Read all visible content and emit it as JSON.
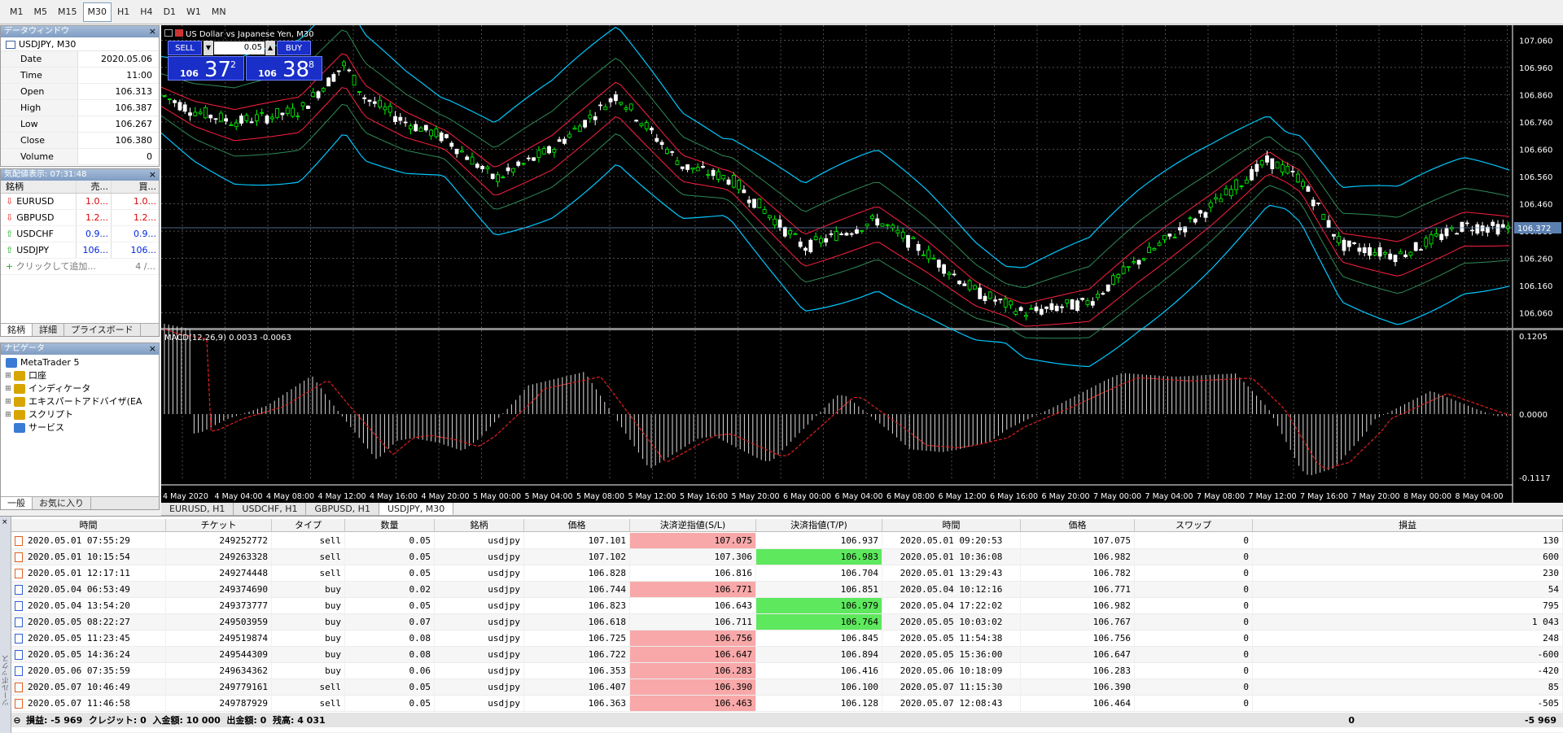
{
  "timeframes": [
    "M1",
    "M5",
    "M15",
    "M30",
    "H1",
    "H4",
    "D1",
    "W1",
    "MN"
  ],
  "active_timeframe": "M30",
  "data_window": {
    "title": "データウィンドウ",
    "symbol": "USDJPY, M30",
    "rows": [
      {
        "k": "Date",
        "v": "2020.05.06"
      },
      {
        "k": "Time",
        "v": "11:00"
      },
      {
        "k": "Open",
        "v": "106.313"
      },
      {
        "k": "High",
        "v": "106.387"
      },
      {
        "k": "Low",
        "v": "106.267"
      },
      {
        "k": "Close",
        "v": "106.380"
      },
      {
        "k": "Volume",
        "v": "0"
      }
    ]
  },
  "market_watch": {
    "title": "気配値表示: 07:31:48",
    "headers": [
      "銘柄",
      "売...",
      "買..."
    ],
    "rows": [
      {
        "sym": "EURUSD",
        "bid": "1.0...",
        "ask": "1.0...",
        "dir": "dn"
      },
      {
        "sym": "GBPUSD",
        "bid": "1.2...",
        "ask": "1.2...",
        "dir": "dn"
      },
      {
        "sym": "USDCHF",
        "bid": "0.9...",
        "ask": "0.9...",
        "dir": "up"
      },
      {
        "sym": "USDJPY",
        "bid": "106...",
        "ask": "106...",
        "dir": "up"
      }
    ],
    "add": "クリックして追加...",
    "count": "4 /...",
    "tabs": [
      "銘柄",
      "詳細",
      "プライスボード"
    ]
  },
  "navigator": {
    "title": "ナビゲータ",
    "root": "MetaTrader 5",
    "items": [
      "口座",
      "インディケータ",
      "エキスパートアドバイザ(EA",
      "スクリプト",
      "サービス"
    ],
    "tabs": [
      "一般",
      "お気に入り"
    ]
  },
  "chart": {
    "title": "US Dollar vs Japanese Yen, M30",
    "sell_label": "SELL",
    "buy_label": "BUY",
    "lot": "0.05",
    "bid_prefix": "106",
    "bid_big": "37",
    "bid_sup": "2",
    "ask_prefix": "106",
    "ask_big": "38",
    "ask_sup": "8",
    "price_labels": [
      "107.060",
      "106.960",
      "106.860",
      "106.760",
      "106.660",
      "106.560",
      "106.460",
      "106.360",
      "106.260",
      "106.160",
      "106.060"
    ],
    "current_price": "106.372",
    "macd_label": "MACD(12,26,9) 0.0033 -0.0063",
    "macd_labels": [
      "0.1205",
      "0.0000",
      "-0.1117"
    ],
    "time_labels": [
      "4 May 2020",
      "4 May 04:00",
      "4 May 08:00",
      "4 May 12:00",
      "4 May 16:00",
      "4 May 20:00",
      "5 May 00:00",
      "5 May 04:00",
      "5 May 08:00",
      "5 May 12:00",
      "5 May 16:00",
      "5 May 20:00",
      "6 May 00:00",
      "6 May 04:00",
      "6 May 08:00",
      "6 May 12:00",
      "6 May 16:00",
      "6 May 20:00",
      "7 May 00:00",
      "7 May 04:00",
      "7 May 08:00",
      "7 May 12:00",
      "7 May 16:00",
      "7 May 20:00",
      "8 May 00:00",
      "8 May 04:00"
    ],
    "tabs": [
      "EURUSD, H1",
      "USDCHF, H1",
      "GBPUSD, H1",
      "USDJPY, M30"
    ],
    "active_tab": "USDJPY, M30",
    "colors": {
      "up": "#00ff00",
      "down": "#ffffff",
      "bb_outer": "#00c8ff",
      "bb_mid": "#ff2040",
      "bb_inner": "#2e8b57",
      "grid": "#7f7f7f"
    }
  },
  "history": {
    "headers": [
      "時間",
      "チケット",
      "タイプ",
      "数量",
      "銘柄",
      "価格",
      "決済逆指値(S/L)",
      "決済指値(T/P)",
      "時間",
      "価格",
      "スワップ",
      "損益"
    ],
    "rows": [
      [
        "2020.05.01 07:55:29",
        "249252772",
        "sell",
        "0.05",
        "usdjpy",
        "107.101",
        "107.075",
        "106.937",
        "2020.05.01 09:20:53",
        "107.075",
        "0",
        "130",
        "sl"
      ],
      [
        "2020.05.01 10:15:54",
        "249263328",
        "sell",
        "0.05",
        "usdjpy",
        "107.102",
        "107.306",
        "106.983",
        "2020.05.01 10:36:08",
        "106.982",
        "0",
        "600",
        "tp"
      ],
      [
        "2020.05.01 12:17:11",
        "249274448",
        "sell",
        "0.05",
        "usdjpy",
        "106.828",
        "106.816",
        "106.704",
        "2020.05.01 13:29:43",
        "106.782",
        "0",
        "230",
        ""
      ],
      [
        "2020.05.04 06:53:49",
        "249374690",
        "buy",
        "0.02",
        "usdjpy",
        "106.744",
        "106.771",
        "106.851",
        "2020.05.04 10:12:16",
        "106.771",
        "0",
        "54",
        "sl"
      ],
      [
        "2020.05.04 13:54:20",
        "249373777",
        "buy",
        "0.05",
        "usdjpy",
        "106.823",
        "106.643",
        "106.979",
        "2020.05.04 17:22:02",
        "106.982",
        "0",
        "795",
        "tp"
      ],
      [
        "2020.05.05 08:22:27",
        "249503959",
        "buy",
        "0.07",
        "usdjpy",
        "106.618",
        "106.711",
        "106.764",
        "2020.05.05 10:03:02",
        "106.767",
        "0",
        "1 043",
        "tp"
      ],
      [
        "2020.05.05 11:23:45",
        "249519874",
        "buy",
        "0.08",
        "usdjpy",
        "106.725",
        "106.756",
        "106.845",
        "2020.05.05 11:54:38",
        "106.756",
        "0",
        "248",
        "sl"
      ],
      [
        "2020.05.05 14:36:24",
        "249544309",
        "buy",
        "0.08",
        "usdjpy",
        "106.722",
        "106.647",
        "106.894",
        "2020.05.05 15:36:00",
        "106.647",
        "0",
        "-600",
        "sl"
      ],
      [
        "2020.05.06 07:35:59",
        "249634362",
        "buy",
        "0.06",
        "usdjpy",
        "106.353",
        "106.283",
        "106.416",
        "2020.05.06 10:18:09",
        "106.283",
        "0",
        "-420",
        "sl"
      ],
      [
        "2020.05.07 10:46:49",
        "249779161",
        "sell",
        "0.05",
        "usdjpy",
        "106.407",
        "106.390",
        "106.100",
        "2020.05.07 11:15:30",
        "106.390",
        "0",
        "85",
        "sl"
      ],
      [
        "2020.05.07 11:46:58",
        "249787929",
        "sell",
        "0.05",
        "usdjpy",
        "106.363",
        "106.463",
        "106.128",
        "2020.05.07 12:08:43",
        "106.464",
        "0",
        "-505",
        "sl"
      ]
    ],
    "summary": "損益: -5 969  クレジット: 0  入金額: 10 000  出金額: 0  残高: 4 031",
    "summary_swap": "0",
    "summary_profit": "-5 969",
    "side_label": "ツールボックス"
  }
}
